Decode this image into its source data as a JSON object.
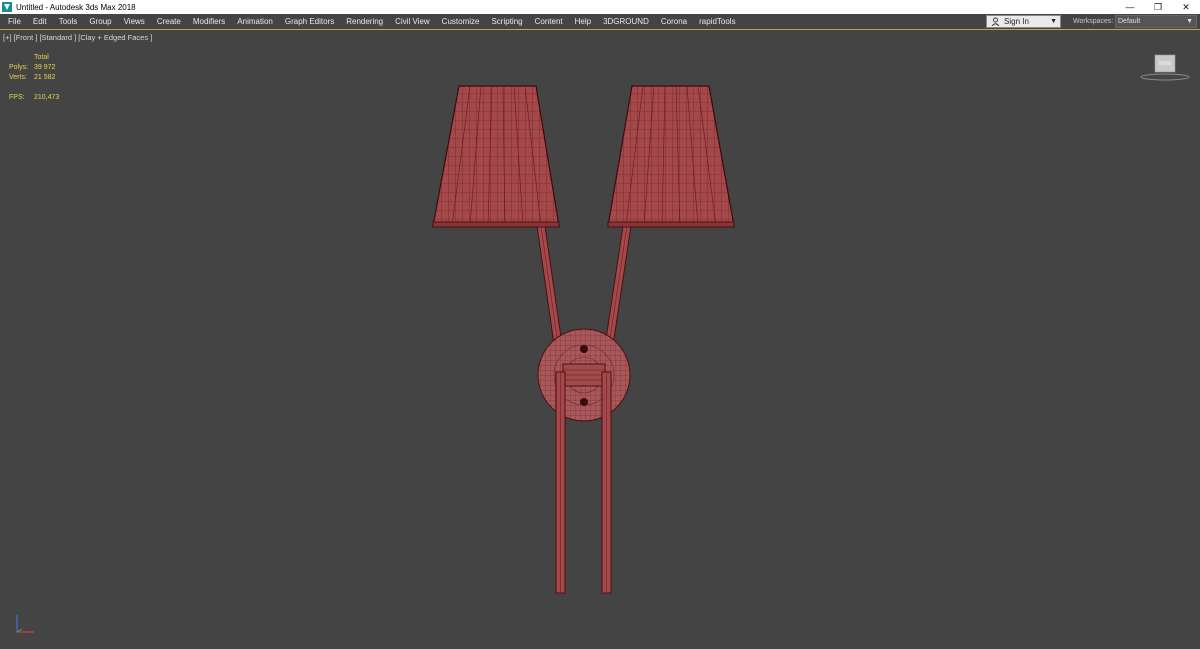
{
  "window": {
    "title": "Untitled - Autodesk 3ds Max 2018",
    "controls": [
      "—",
      "❐",
      "✕"
    ]
  },
  "menubar": {
    "items": [
      "File",
      "Edit",
      "Tools",
      "Group",
      "Views",
      "Create",
      "Modifiers",
      "Animation",
      "Graph Editors",
      "Rendering",
      "Civil View",
      "Customize",
      "Scripting",
      "Content",
      "Help",
      "3DGROUND",
      "Corona",
      "rapidTools"
    ],
    "sign_in": "Sign In",
    "workspaces_label": "Workspaces:",
    "workspaces_value": "Default"
  },
  "viewport": {
    "label": "[+] [Front ] [Standard ] [Clay + Edged Faces ]",
    "stats": {
      "total_label": "Total",
      "polys_label": "Polys:",
      "polys_value": "39 972",
      "verts_label": "Verts:",
      "verts_value": "21 582",
      "fps_label": "FPS:",
      "fps_value": "210,473"
    }
  },
  "colors": {
    "viewport_bg": "#444444",
    "model_fill": "#a0484a",
    "wire": "#5a1a1c",
    "stats_text": "#e8d24a"
  }
}
